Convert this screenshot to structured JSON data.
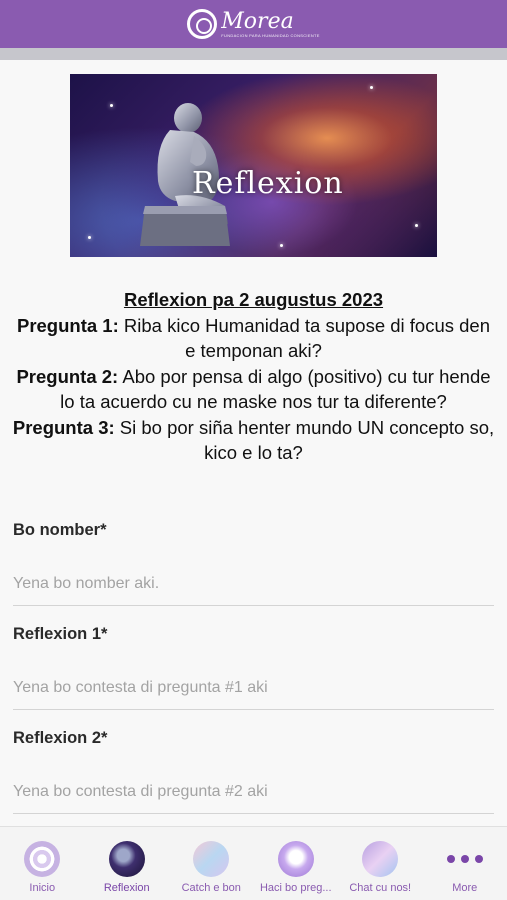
{
  "header": {
    "brand_name": "Morea",
    "brand_tagline": "FUNDACION PARA HUMANIDAD CONSCIENTE",
    "brand_color": "#8a5bb0"
  },
  "banner": {
    "title": "Reflexion"
  },
  "article": {
    "title": "Reflexion pa 2 augustus 2023",
    "questions": [
      {
        "label": "Pregunta 1:",
        "text": " Riba kico Humanidad ta supose di focus den e temponan aki?"
      },
      {
        "label": "Pregunta 2:",
        "text": " Abo por pensa di algo (positivo) cu tur hende lo ta acuerdo cu ne maske nos tur ta diferente?"
      },
      {
        "label": "Pregunta 3:",
        "text": " Si bo por siña henter mundo UN concepto so, kico e lo ta?"
      }
    ]
  },
  "form": {
    "fields": [
      {
        "label": "Bo nomber*",
        "placeholder": "Yena bo nomber aki.",
        "value": ""
      },
      {
        "label": "Reflexion 1*",
        "placeholder": "Yena bo contesta di pregunta #1 aki",
        "value": ""
      },
      {
        "label": "Reflexion 2*",
        "placeholder": "Yena bo contesta di pregunta #2 aki",
        "value": ""
      }
    ]
  },
  "tabbar": {
    "tabs": [
      {
        "label": "Inicio",
        "icon": "spiral-logo-icon",
        "active": false
      },
      {
        "label": "Reflexion",
        "icon": "thinker-icon",
        "active": true
      },
      {
        "label": "Catch e bon",
        "icon": "catch-image-icon",
        "active": false
      },
      {
        "label": "Haci bo preg...",
        "icon": "question-image-icon",
        "active": false
      },
      {
        "label": "Chat cu nos!",
        "icon": "chat-image-icon",
        "active": false
      },
      {
        "label": "More",
        "icon": "more-dots-icon",
        "active": false
      }
    ]
  }
}
